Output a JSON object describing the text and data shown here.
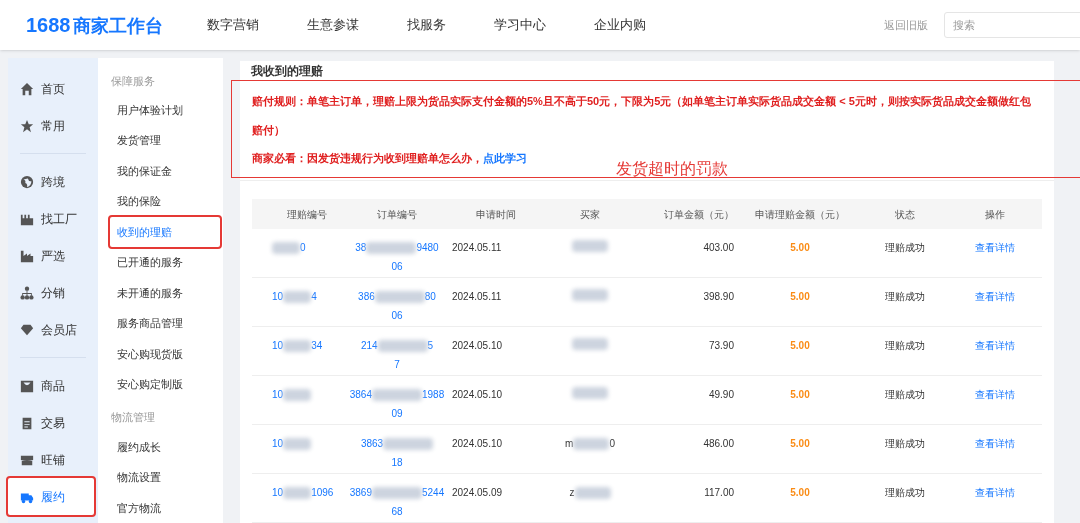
{
  "header": {
    "logo_number": "1688",
    "logo_text": "商家工作台",
    "nav": [
      "数字营销",
      "生意参谋",
      "找服务",
      "学习中心",
      "企业内购"
    ],
    "old_version": "返回旧版",
    "search": {
      "placeholder": "搜索"
    }
  },
  "sidebar": {
    "items": [
      {
        "kind": "item",
        "label": "首页",
        "selected": false,
        "highlighted": false
      },
      {
        "kind": "item",
        "label": "常用",
        "selected": false,
        "highlighted": false
      },
      {
        "kind": "divider"
      },
      {
        "kind": "item",
        "label": "跨境",
        "selected": false,
        "highlighted": false
      },
      {
        "kind": "item",
        "label": "找工厂",
        "selected": false,
        "highlighted": false
      },
      {
        "kind": "item",
        "label": "严选",
        "selected": false,
        "highlighted": false
      },
      {
        "kind": "item",
        "label": "分销",
        "selected": false,
        "highlighted": false
      },
      {
        "kind": "item",
        "label": "会员店",
        "selected": false,
        "highlighted": false
      },
      {
        "kind": "divider"
      },
      {
        "kind": "item",
        "label": "商品",
        "selected": false,
        "highlighted": false
      },
      {
        "kind": "item",
        "label": "交易",
        "selected": false,
        "highlighted": false
      },
      {
        "kind": "item",
        "label": "旺铺",
        "selected": false,
        "highlighted": false
      },
      {
        "kind": "item",
        "label": "履约",
        "selected": true,
        "highlighted": true
      }
    ]
  },
  "submenu": {
    "groups": [
      {
        "title": "保障服务",
        "items": [
          {
            "label": "用户体验计划",
            "selected": false,
            "highlighted": false
          },
          {
            "label": "发货管理",
            "selected": false,
            "highlighted": false
          },
          {
            "label": "我的保证金",
            "selected": false,
            "highlighted": false
          },
          {
            "label": "我的保险",
            "selected": false,
            "highlighted": false
          },
          {
            "label": "收到的理赔",
            "selected": true,
            "highlighted": true
          },
          {
            "label": "已开通的服务",
            "selected": false,
            "highlighted": false
          },
          {
            "label": "未开通的服务",
            "selected": false,
            "highlighted": false
          },
          {
            "label": "服务商品管理",
            "selected": false,
            "highlighted": false
          },
          {
            "label": "安心购现货版",
            "selected": false,
            "highlighted": false
          },
          {
            "label": "安心购定制版",
            "selected": false,
            "highlighted": false
          }
        ]
      },
      {
        "title": "物流管理",
        "items": [
          {
            "label": "履约成长",
            "selected": false,
            "highlighted": false
          },
          {
            "label": "物流设置",
            "selected": false,
            "highlighted": false
          },
          {
            "label": "官方物流",
            "selected": false,
            "highlighted": false
          }
        ]
      }
    ]
  },
  "main": {
    "title": "我收到的理赔",
    "rule": "赔付规则：单笔主订单，理赔上限为货品实际支付金额的5%且不高于50元，下限为5元（如单笔主订单实际货品成交金额 < 5元时，则按实际货品成交金额做红包赔付）",
    "notice": "商家必看：因发货违规行为收到理赔单怎么办，",
    "notice_link": "点此学习",
    "annotation": "发货超时的罚款",
    "table": {
      "columns": [
        "理赔编号",
        "订单编号",
        "申请时间",
        "买家",
        "订单金额（元）",
        "申请理赔金额（元）",
        "状态",
        "操作"
      ],
      "rows": [
        {
          "claim_id": {
            "end": "0"
          },
          "order_id": {
            "start": "38",
            "end": "9480",
            "line2": "06"
          },
          "date": "2024.05.11",
          "buyer": {},
          "amount": "403.00",
          "claim_amount": "5.00",
          "status": "理赔成功",
          "action": "查看详情"
        },
        {
          "claim_id": {
            "start": "10",
            "end": "4"
          },
          "order_id": {
            "start": "386",
            "end": "80",
            "line2": "06"
          },
          "date": "2024.05.11",
          "buyer": {},
          "amount": "398.90",
          "claim_amount": "5.00",
          "status": "理赔成功",
          "action": "查看详情"
        },
        {
          "claim_id": {
            "start": "10",
            "end": "34"
          },
          "order_id": {
            "start": "214",
            "end": "5",
            "line2": "7"
          },
          "date": "2024.05.10",
          "buyer": {},
          "amount": "73.90",
          "claim_amount": "5.00",
          "status": "理赔成功",
          "action": "查看详情"
        },
        {
          "claim_id": {
            "start": "10"
          },
          "order_id": {
            "start": "3864",
            "end": "1988",
            "line2": "09"
          },
          "date": "2024.05.10",
          "buyer": {},
          "amount": "49.90",
          "claim_amount": "5.00",
          "status": "理赔成功",
          "action": "查看详情"
        },
        {
          "claim_id": {
            "start": "10"
          },
          "order_id": {
            "start": "3863",
            "line2": "18"
          },
          "date": "2024.05.10",
          "buyer": {
            "start": "m",
            "end": "0"
          },
          "amount": "486.00",
          "claim_amount": "5.00",
          "status": "理赔成功",
          "action": "查看详情"
        },
        {
          "claim_id": {
            "start": "10",
            "end": "1096"
          },
          "order_id": {
            "start": "3869",
            "end": "5244",
            "line2": "68"
          },
          "date": "2024.05.09",
          "buyer": {
            "start": "z"
          },
          "amount": "117.00",
          "claim_amount": "5.00",
          "status": "理赔成功",
          "action": "查看详情"
        }
      ]
    }
  }
}
